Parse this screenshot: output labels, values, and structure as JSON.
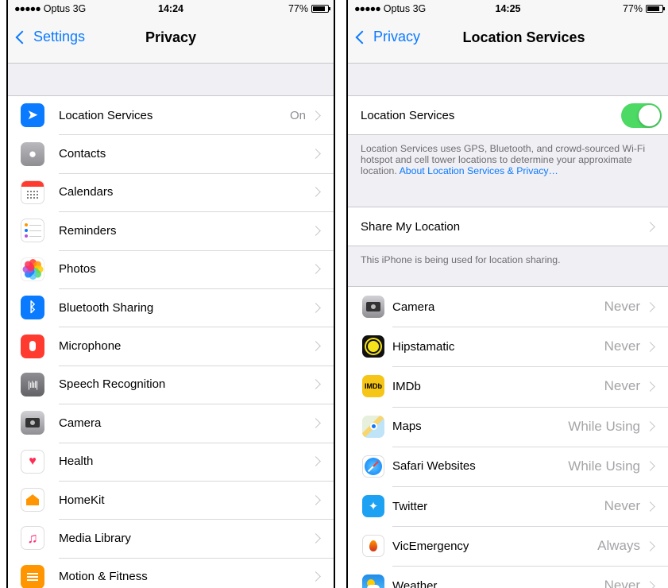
{
  "left": {
    "status": {
      "carrier": "Optus",
      "network": "3G",
      "time": "14:24",
      "battery": "77%"
    },
    "nav": {
      "back_label": "Settings",
      "title": "Privacy"
    },
    "items": [
      {
        "label": "Location Services",
        "value": "On",
        "icon": "location-arrow-icon"
      },
      {
        "label": "Contacts",
        "value": "",
        "icon": "contacts-icon"
      },
      {
        "label": "Calendars",
        "value": "",
        "icon": "calendar-icon"
      },
      {
        "label": "Reminders",
        "value": "",
        "icon": "reminders-icon"
      },
      {
        "label": "Photos",
        "value": "",
        "icon": "photos-icon"
      },
      {
        "label": "Bluetooth Sharing",
        "value": "",
        "icon": "bluetooth-icon"
      },
      {
        "label": "Microphone",
        "value": "",
        "icon": "microphone-icon"
      },
      {
        "label": "Speech Recognition",
        "value": "",
        "icon": "speech-waveform-icon"
      },
      {
        "label": "Camera",
        "value": "",
        "icon": "camera-icon"
      },
      {
        "label": "Health",
        "value": "",
        "icon": "health-heart-icon"
      },
      {
        "label": "HomeKit",
        "value": "",
        "icon": "homekit-house-icon"
      },
      {
        "label": "Media Library",
        "value": "",
        "icon": "music-note-icon"
      },
      {
        "label": "Motion & Fitness",
        "value": "",
        "icon": "motion-fitness-icon"
      }
    ]
  },
  "right": {
    "status": {
      "carrier": "Optus",
      "network": "3G",
      "time": "14:25",
      "battery": "77%"
    },
    "nav": {
      "back_label": "Privacy",
      "title": "Location Services"
    },
    "toggle_row": {
      "label": "Location Services",
      "enabled": true
    },
    "description": "Location Services uses GPS, Bluetooth, and crowd-sourced Wi-Fi hotspot and cell tower locations to determine your approximate location.",
    "description_link": "About Location Services & Privacy…",
    "share_row": {
      "label": "Share My Location"
    },
    "share_note": "This iPhone is being used for location sharing.",
    "apps": [
      {
        "label": "Camera",
        "value": "Never",
        "icon": "camera-icon"
      },
      {
        "label": "Hipstamatic",
        "value": "Never",
        "icon": "hipstamatic-icon"
      },
      {
        "label": "IMDb",
        "value": "Never",
        "icon": "imdb-icon",
        "icon_text": "IMDb"
      },
      {
        "label": "Maps",
        "value": "While Using",
        "icon": "maps-icon"
      },
      {
        "label": "Safari Websites",
        "value": "While Using",
        "icon": "safari-compass-icon"
      },
      {
        "label": "Twitter",
        "value": "Never",
        "icon": "twitter-bird-icon"
      },
      {
        "label": "VicEmergency",
        "value": "Always",
        "icon": "vicemergency-flame-icon"
      },
      {
        "label": "Weather",
        "value": "Never",
        "icon": "weather-icon"
      }
    ]
  },
  "colors": {
    "ios_blue": "#0a7aff",
    "toggle_on": "#4cd964",
    "group_bg": "#efeff4",
    "secondary_text": "#8e8e93"
  }
}
